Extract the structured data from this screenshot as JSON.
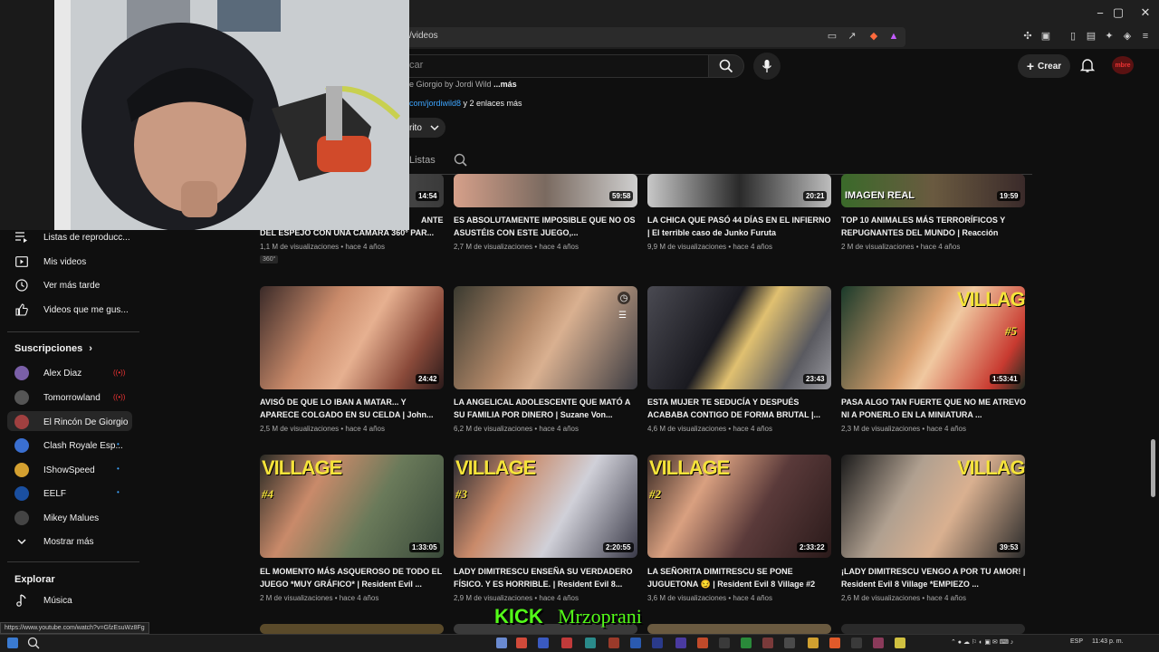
{
  "browser": {
    "url_fragment": "/videos",
    "window_controls": [
      "−",
      "▢",
      "✕"
    ]
  },
  "header": {
    "search_placeholder": "car",
    "create_label": "Crear",
    "avatar_text": "mbre"
  },
  "channel": {
    "description_prefix": "e Giorgio by Jordi Wild",
    "description_more": "...más",
    "links_text": "com/jordiwild8",
    "links_suffix": " y 2 enlaces más",
    "subscribe_label": "rito",
    "tab_lists": "Listas"
  },
  "sidebar": {
    "items": [
      {
        "label": "Listas de reproducc...",
        "icon": "playlist-icon"
      },
      {
        "label": "Mis videos",
        "icon": "my-videos-icon"
      },
      {
        "label": "Ver más tarde",
        "icon": "watch-later-icon"
      },
      {
        "label": "Videos que me gus...",
        "icon": "like-icon"
      }
    ],
    "subscriptions_title": "Suscripciones",
    "subscriptions": [
      {
        "label": "Alex Diaz",
        "color": "#7a5fa8",
        "status": "live"
      },
      {
        "label": "Tomorrowland",
        "color": "#555555",
        "status": "live"
      },
      {
        "label": "El Rincón De Giorgio",
        "color": "#a04040",
        "status": ""
      },
      {
        "label": "Clash Royale Esp...",
        "color": "#3a6fd0",
        "status": "new"
      },
      {
        "label": "IShowSpeed",
        "color": "#d4a030",
        "status": "new"
      },
      {
        "label": "EELF",
        "color": "#1a4fa0",
        "status": "new"
      },
      {
        "label": "Mikey Malues",
        "color": "#444444",
        "status": ""
      }
    ],
    "show_more": "Mostrar más",
    "explore_title": "Explorar",
    "music": "Música"
  },
  "videos": [
    {
      "title": "DEL ESPEJO CON UNA CÁMARA 360° PAR...",
      "title_pre": "ANTE",
      "meta": "1,1 M de visualizaciones • hace 4 años",
      "duration": "14:54",
      "badge": "360°"
    },
    {
      "title": "ES ABSOLUTAMENTE IMPOSIBLE QUE NO OS ASUSTÉIS CON ESTE JUEGO,...",
      "meta": "2,7 M de visualizaciones • hace 4 años",
      "duration": "59:58"
    },
    {
      "title": "LA CHICA QUE PASÓ 44 DÍAS EN EL INFIERNO | El terrible caso de Junko Furuta",
      "meta": "9,9 M de visualizaciones • hace 4 años",
      "duration": "20:21"
    },
    {
      "title": "TOP 10 ANIMALES MÁS TERRORÍFICOS Y REPUGNANTES DEL MUNDO | Reacción",
      "meta": "2 M de visualizaciones • hace 4 años",
      "duration": "19:59",
      "overlay": "IMAGEN REAL"
    },
    {
      "title": "AVISÓ DE QUE LO IBAN A MATAR... Y APARECE COLGADO EN SU CELDA | John...",
      "meta": "2,5 M de visualizaciones • hace 4 años",
      "duration": "24:42"
    },
    {
      "title": "LA ANGELICAL ADOLESCENTE QUE MATÓ A SU FAMILIA POR DINERO | Suzane Von...",
      "meta": "6,2 M de visualizaciones • hace 4 años",
      "duration": ""
    },
    {
      "title": "ESTA MUJER TE SEDUCÍA Y DESPUÉS ACABABA CONTIGO DE FORMA BRUTAL |...",
      "meta": "4,6 M de visualizaciones • hace 4 años",
      "duration": "23:43"
    },
    {
      "title": "PASA ALGO TAN FUERTE QUE NO ME ATREVO NI A PONERLO EN LA MINIATURA ...",
      "meta": "2,3 M de visualizaciones • hace 4 años",
      "duration": "1:53:41",
      "overlay": "VILLAGE",
      "num": "#5"
    },
    {
      "title": "EL MOMENTO MÁS ASQUEROSO DE TODO EL JUEGO *MUY GRÁFICO* | Resident Evil ...",
      "meta": "2 M de visualizaciones • hace 4 años",
      "duration": "1:33:05",
      "overlay": "VILLAGE",
      "num": "#4"
    },
    {
      "title": "LADY DIMITRESCU ENSEÑA SU VERDADERO FÍSICO. Y ES HORRIBLE. | Resident Evil 8...",
      "meta": "2,9 M de visualizaciones • hace 4 años",
      "duration": "2:20:55",
      "overlay": "VILLAGE",
      "num": "#3"
    },
    {
      "title": "LA SEÑORITA DIMITRESCU SE PONE JUGUETONA 😏 | Resident Evil 8 Village #2",
      "meta": "3,6 M de visualizaciones • hace 4 años",
      "duration": "2:33:22",
      "overlay": "VILLAGE",
      "num": "#2"
    },
    {
      "title": "¡LADY DIMITRESCU VENGO A POR TU AMOR! | Resident Evil 8 Village *EMPIEZO ...",
      "meta": "2,6 M de visualizaciones • hace 4 años",
      "duration": "39:53",
      "overlay": "VILLAGE"
    }
  ],
  "status_url": "https://www.youtube.com/watch?v=GfzEsuWz8Fg",
  "stream_overlay": {
    "brand": "KICK",
    "name": "Mrzoprani"
  },
  "taskbar": {
    "lang": "ESP",
    "time": "11:43 p. m."
  },
  "colors": {
    "bg": "#0f0f0f",
    "accent_blue": "#3ea6ff",
    "kick_green": "#53fc18",
    "village_yellow": "#f5e33a"
  }
}
